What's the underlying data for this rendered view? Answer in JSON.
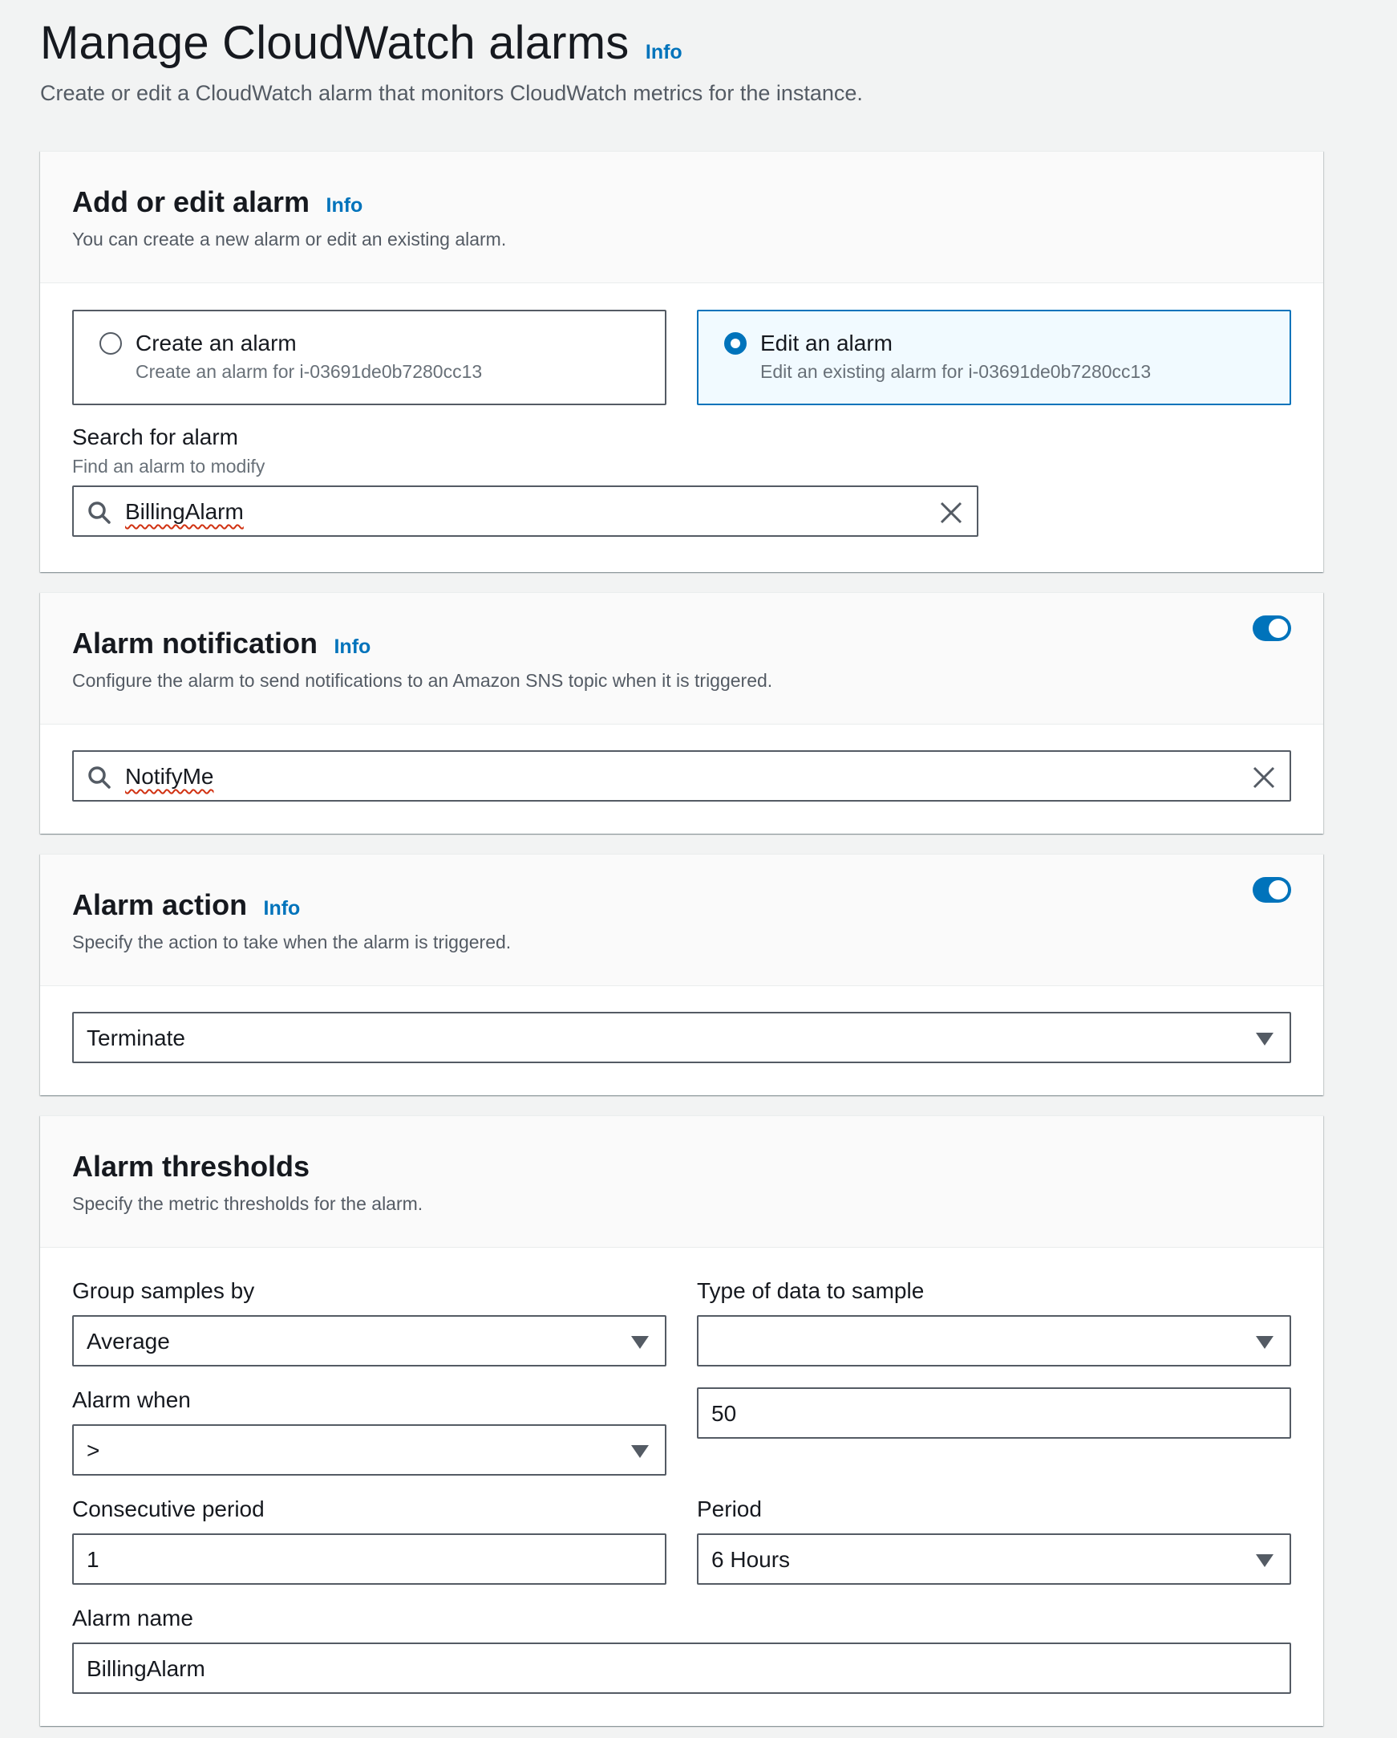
{
  "header": {
    "title": "Manage CloudWatch alarms",
    "info": "Info",
    "description": "Create or edit a CloudWatch alarm that monitors CloudWatch metrics for the instance."
  },
  "add_edit": {
    "title": "Add or edit alarm",
    "info": "Info",
    "description": "You can create a new alarm or edit an existing alarm.",
    "create": {
      "label": "Create an alarm",
      "description": "Create an alarm for i-03691de0b7280cc13",
      "selected": false
    },
    "edit": {
      "label": "Edit an alarm",
      "description": "Edit an existing alarm for i-03691de0b7280cc13",
      "selected": true
    },
    "search": {
      "label": "Search for alarm",
      "hint": "Find an alarm to modify",
      "value": "BillingAlarm"
    }
  },
  "notification": {
    "title": "Alarm notification",
    "info": "Info",
    "description": "Configure the alarm to send notifications to an Amazon SNS topic when it is triggered.",
    "enabled": true,
    "topic_value": "NotifyMe"
  },
  "action": {
    "title": "Alarm action",
    "info": "Info",
    "description": "Specify the action to take when the alarm is triggered.",
    "enabled": true,
    "selected": "Terminate"
  },
  "thresholds": {
    "title": "Alarm thresholds",
    "description": "Specify the metric thresholds for the alarm.",
    "group_samples_by": {
      "label": "Group samples by",
      "value": "Average"
    },
    "type_of_data": {
      "label": "Type of data to sample",
      "value": ""
    },
    "alarm_when": {
      "label": "Alarm when",
      "operator": ">",
      "threshold": "50"
    },
    "consecutive_period": {
      "label": "Consecutive period",
      "value": "1"
    },
    "period": {
      "label": "Period",
      "value": "6 Hours"
    },
    "alarm_name": {
      "label": "Alarm name",
      "value": "BillingAlarm"
    }
  },
  "colors": {
    "accent": "#0073bb",
    "border": "#545b64",
    "text": "#16191f",
    "muted": "#687078"
  }
}
